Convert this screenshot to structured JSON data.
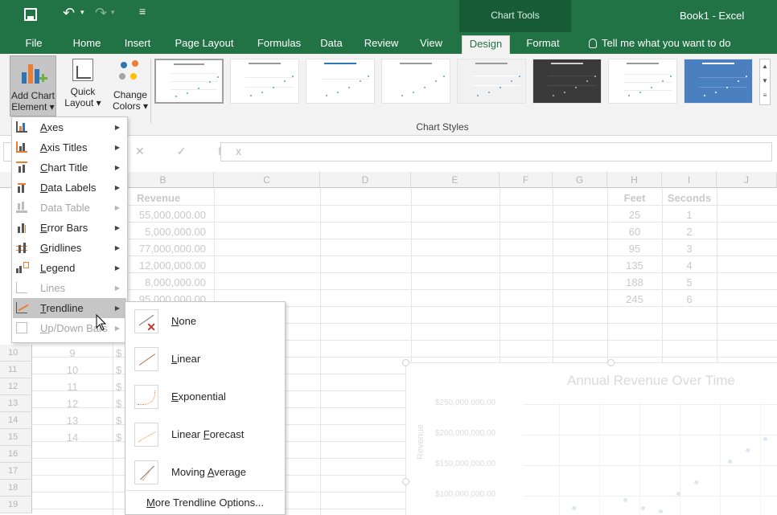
{
  "window": {
    "doc_title": "Book1 - Excel",
    "contextual_group": "Chart Tools"
  },
  "tabs": [
    "File",
    "Home",
    "Insert",
    "Page Layout",
    "Formulas",
    "Data",
    "Review",
    "View",
    "Design",
    "Format"
  ],
  "active_tab": "Design",
  "tell_me": "Tell me what you want to do",
  "ribbon": {
    "add_chart_line1": "Add Chart",
    "add_chart_line2": "Element ▾",
    "quick_line1": "Quick",
    "quick_line2": "Layout ▾",
    "change_line1": "Change",
    "change_line2": "Colors ▾",
    "chart_styles_label": "Chart Styles"
  },
  "formula_bar": {
    "fx_symbols": "✕ ✓ fx"
  },
  "columns": [
    "B",
    "C",
    "D",
    "E",
    "F",
    "G",
    "H",
    "I",
    "J"
  ],
  "rows": [
    "10",
    "11",
    "12",
    "13",
    "14",
    "15",
    "16",
    "17",
    "18",
    "19"
  ],
  "sheet": {
    "revenue_header": "Revenue",
    "revenues": [
      "55,000,000.00",
      "5,000,000.00",
      "77,000,000.00",
      "12,000,000.00",
      "8,000,000.00",
      "95,000,000.00"
    ],
    "index_values": [
      "9",
      "10",
      "11",
      "12",
      "13",
      "14"
    ],
    "dollar": "$",
    "feet_header": "Feet",
    "seconds_header": "Seconds",
    "feet": [
      "25",
      "60",
      "95",
      "135",
      "188",
      "245"
    ],
    "seconds": [
      "1",
      "2",
      "3",
      "4",
      "5",
      "6"
    ]
  },
  "chart": {
    "title": "Annual Revenue Over Time",
    "y_axis_label": "Revenue",
    "y_ticks": [
      "$250,000,000.00",
      "$200,000,000.00",
      "$150,000,000.00",
      "$100,000,000.00"
    ]
  },
  "add_element_menu": [
    {
      "label": "Axes",
      "underline": "A",
      "rest": "xes",
      "enabled": true,
      "icon": "axes-icon"
    },
    {
      "label": "Axis Titles",
      "underline": "A",
      "rest": "xis Titles",
      "enabled": true,
      "icon": "axis-titles-icon"
    },
    {
      "label": "Chart Title",
      "underline": "C",
      "rest": "hart Title",
      "enabled": true,
      "icon": "chart-title-icon"
    },
    {
      "label": "Data Labels",
      "underline": "D",
      "rest": "ata Labels",
      "enabled": true,
      "icon": "data-labels-icon"
    },
    {
      "label": "Data Table",
      "underline": "",
      "rest": "Data Table",
      "enabled": false,
      "icon": "data-table-icon"
    },
    {
      "label": "Error Bars",
      "underline": "E",
      "rest": "rror Bars",
      "enabled": true,
      "icon": "error-bars-icon"
    },
    {
      "label": "Gridlines",
      "underline": "G",
      "rest": "ridlines",
      "enabled": true,
      "icon": "gridlines-icon"
    },
    {
      "label": "Legend",
      "underline": "L",
      "rest": "egend",
      "enabled": true,
      "icon": "legend-icon"
    },
    {
      "label": "Lines",
      "underline": "",
      "rest": "Lines",
      "enabled": false,
      "icon": "lines-icon"
    },
    {
      "label": "Trendline",
      "underline": "T",
      "rest": "rendline",
      "enabled": true,
      "icon": "trendline-icon"
    },
    {
      "label": "Up/Down Bars",
      "underline": "U",
      "rest": "p/Down Bars",
      "enabled": false,
      "icon": "up-down-bars-icon"
    }
  ],
  "trendline_menu": [
    {
      "label": "None",
      "underline": "N",
      "rest": "one"
    },
    {
      "label": "Linear",
      "underline": "L",
      "rest": "inear"
    },
    {
      "label": "Exponential",
      "underline": "E",
      "rest": "xponential"
    },
    {
      "label": "Linear Forecast",
      "pre": "Linear ",
      "underline": "F",
      "rest": "orecast"
    },
    {
      "label": "Moving Average",
      "pre": "Moving ",
      "underline": "A",
      "rest": "verage"
    }
  ],
  "more_trendline": {
    "underline": "M",
    "rest": "ore Trendline Options..."
  },
  "colors": {
    "excel_green": "#217346",
    "accent_blue": "#2e75b6",
    "trend_orange": "#ed7d31"
  }
}
